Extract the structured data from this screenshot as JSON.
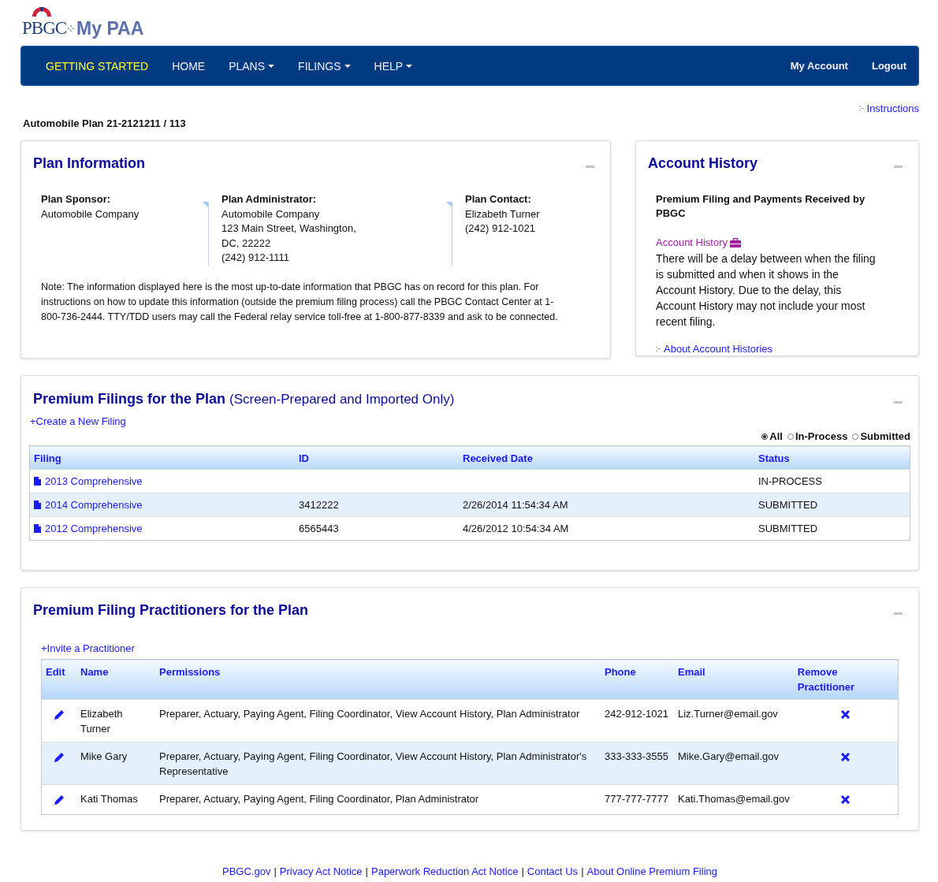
{
  "header": {
    "logo_text": "PBGC",
    "app_name": "My PAA"
  },
  "nav": {
    "items": [
      {
        "label": "GETTING STARTED",
        "selected": true,
        "dropdown": false
      },
      {
        "label": "HOME",
        "selected": false,
        "dropdown": false
      },
      {
        "label": "PLANS",
        "selected": false,
        "dropdown": true
      },
      {
        "label": "FILINGS",
        "selected": false,
        "dropdown": true
      },
      {
        "label": "HELP",
        "selected": false,
        "dropdown": true
      }
    ],
    "right_items": [
      "My Account",
      "Logout"
    ]
  },
  "instructions_link": "Instructions",
  "plan_title": "Automobile Plan  21-2121211 / 113",
  "plan_information": {
    "title": "Plan Information",
    "columns": [
      {
        "heading": "Plan Sponsor:",
        "lines": [
          "Automobile Company"
        ]
      },
      {
        "heading": "Plan Administrator:",
        "lines": [
          "Automobile Company",
          "123 Main Street, Washington,",
          "DC, 22222",
          "(242) 912-1111"
        ]
      },
      {
        "heading": "Plan Contact:",
        "lines": [
          "Elizabeth Turner",
          "(242) 912-1021"
        ]
      }
    ],
    "note": "Note: The information displayed here is the most up-to-date information that PBGC has on record for this plan. For instructions on how to update this information (outside the premium filing process) call the PBGC Contact Center at 1-800-736-2444. TTY/TDD users may call the Federal relay service toll-free at 1-800-877-8339 and ask to be connected."
  },
  "account_history": {
    "title": "Account History",
    "subtitle": "Premium Filing and Payments Received by PBGC",
    "link": "Account History",
    "text": "There will be a delay between when the filing is submitted and when it shows in the Account History. Due to the delay, this Account History may not include your most recent filing.",
    "about_link": "About Account Histories"
  },
  "premium_filings": {
    "title": "Premium Filings for the Plan",
    "title_note": "(Screen-Prepared and Imported Only)",
    "create_link": "+Create a New Filing",
    "filters": [
      {
        "label": "All",
        "selected": true
      },
      {
        "label": "In-Process",
        "selected": false
      },
      {
        "label": "Submitted",
        "selected": false
      }
    ],
    "columns": [
      "Filing",
      "ID",
      "Received Date",
      "Status"
    ],
    "rows": [
      {
        "filing": "2013 Comprehensive",
        "id": "",
        "received": "",
        "status": "IN-PROCESS"
      },
      {
        "filing": "2014 Comprehensive",
        "id": "3412222",
        "received": "2/26/2014 11:54:34 AM",
        "status": "SUBMITTED"
      },
      {
        "filing": "2012 Comprehensive",
        "id": "6565443",
        "received": "4/26/2012 10:54:34 AM",
        "status": "SUBMITTED"
      }
    ]
  },
  "practitioners": {
    "title": "Premium Filing Practitioners for the Plan",
    "invite_link": "+Invite a Practitioner",
    "columns": [
      "Edit",
      "Name",
      "Permissions",
      "Phone",
      "Email",
      "Remove Practitioner"
    ],
    "rows": [
      {
        "name": "Elizabeth Turner",
        "permissions": "Preparer, Actuary, Paying Agent, Filing Coordinator, View Account History, Plan Administrator",
        "phone": "242-912-1021",
        "email": "Liz.Turner@email.gov"
      },
      {
        "name": "Mike Gary",
        "permissions": "Preparer, Actuary, Paying Agent, Filing Coordinator, View Account History, Plan Administrator's Representative",
        "phone": "333-333-3555",
        "email": "Mike.Gary@email.gov"
      },
      {
        "name": "Kati Thomas",
        "permissions": "Preparer, Actuary, Paying Agent, Filing Coordinator, Plan Administrator",
        "phone": "777-777-7777",
        "email": "Kati.Thomas@email.gov"
      }
    ]
  },
  "footer": {
    "separator": "|",
    "links": [
      "PBGC.gov",
      "Privacy Act Notice",
      "Paperwork Reduction Act Notice",
      "Contact Us",
      "About Online Premium Filing"
    ]
  }
}
